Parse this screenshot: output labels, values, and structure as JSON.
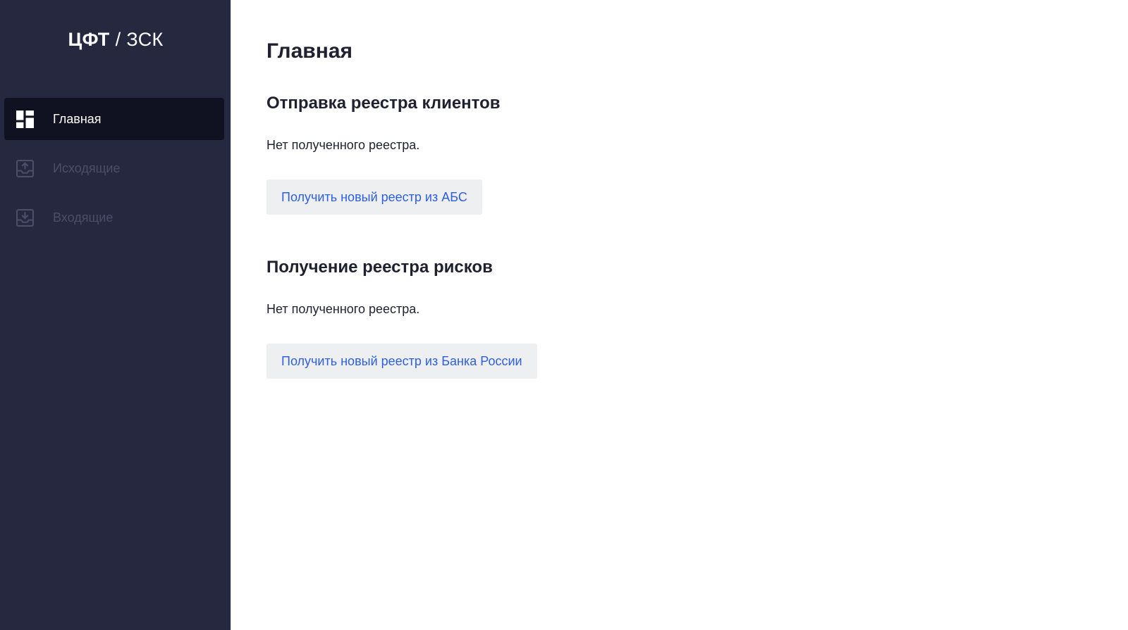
{
  "brand": {
    "name_strong": "ЦФТ",
    "separator": "/",
    "name_light": "ЗСК"
  },
  "sidebar": {
    "items": [
      {
        "label": "Главная",
        "icon": "dashboard-icon",
        "active": true
      },
      {
        "label": "Исходящие",
        "icon": "outbox-upload-icon",
        "active": false
      },
      {
        "label": "Входящие",
        "icon": "inbox-download-icon",
        "active": false
      }
    ]
  },
  "main": {
    "title": "Главная",
    "sections": [
      {
        "title": "Отправка реестра клиентов",
        "status": "Нет полученного реестра.",
        "button_label": "Получить новый реестр из АБС"
      },
      {
        "title": "Получение реестра рисков",
        "status": "Нет полученного реестра.",
        "button_label": "Получить новый реестр из Банка России"
      }
    ]
  },
  "colors": {
    "sidebar_bg": "#262840",
    "sidebar_active_bg": "#101222",
    "sidebar_inactive_text": "#4b4e66",
    "heading_text": "#1f2030",
    "button_bg": "#eeeff1",
    "button_text": "#2d5fe0"
  }
}
